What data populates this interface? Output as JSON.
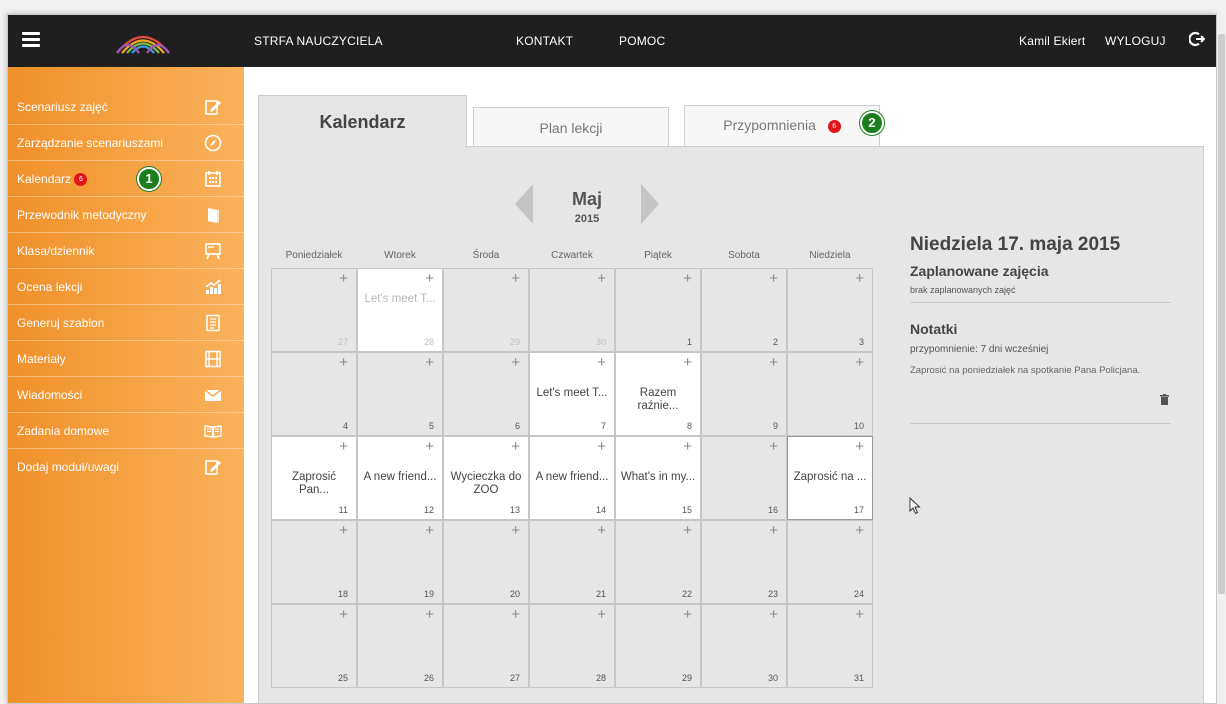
{
  "header": {
    "title": "STRFA NAUCZYCIELA",
    "kontakt": "KONTAKT",
    "pomoc": "POMOC",
    "user": "Kamil Ekiert",
    "logout": "WYLOGUJ",
    "icons": [
      "menu-icon",
      "rainbow-logo",
      "logout-icon"
    ]
  },
  "sidebar": {
    "items": [
      {
        "label": "Scenariusz zajęć",
        "icon": "edit-icon"
      },
      {
        "label": "Zarządzanie scenariuszami",
        "icon": "compass-icon"
      },
      {
        "label": "Kalendarz",
        "icon": "calendar-icon",
        "badge": "6",
        "marker": "1"
      },
      {
        "label": "Przewodnik metodyczny",
        "icon": "book-icon"
      },
      {
        "label": "Klasa/dziennik",
        "icon": "blackboard-icon"
      },
      {
        "label": "Ocena lekcji",
        "icon": "chart-icon"
      },
      {
        "label": "Generuj szablon",
        "icon": "document-icon"
      },
      {
        "label": "Materiały",
        "icon": "film-icon"
      },
      {
        "label": "Wiadomości",
        "icon": "envelope-icon"
      },
      {
        "label": "Zadania domowe",
        "icon": "open-book-icon"
      },
      {
        "label": "Dodaj moduł/uwagi",
        "icon": "edit-icon"
      }
    ]
  },
  "tabs": {
    "calendar": "Kalendarz",
    "plan": "Plan lekcji",
    "reminders": "Przypomnienia",
    "reminders_badge": "6",
    "reminders_marker": "2"
  },
  "calendar": {
    "month": "Maj",
    "year": "2015",
    "weekdays": [
      "Poniedziałek",
      "Wtorek",
      "Środa",
      "Czwartek",
      "Piątek",
      "Sobota",
      "Niedziela"
    ],
    "weeks": [
      [
        {
          "day": "27",
          "faded": true,
          "event": "",
          "active": false
        },
        {
          "day": "28",
          "faded": true,
          "event": "Let's meet T...",
          "active": true
        },
        {
          "day": "29",
          "faded": true,
          "event": "",
          "active": false
        },
        {
          "day": "30",
          "faded": true,
          "event": "",
          "active": false
        },
        {
          "day": "1",
          "faded": false,
          "event": "",
          "active": false
        },
        {
          "day": "2",
          "faded": false,
          "event": "",
          "active": false
        },
        {
          "day": "3",
          "faded": false,
          "event": "",
          "active": false
        }
      ],
      [
        {
          "day": "4",
          "faded": false,
          "event": "",
          "active": false
        },
        {
          "day": "5",
          "faded": false,
          "event": "",
          "active": false
        },
        {
          "day": "6",
          "faded": false,
          "event": "",
          "active": false
        },
        {
          "day": "7",
          "faded": false,
          "event": "Let's meet T...",
          "active": true
        },
        {
          "day": "8",
          "faded": false,
          "event": "Razem raźnie...",
          "active": true
        },
        {
          "day": "9",
          "faded": false,
          "event": "",
          "active": false
        },
        {
          "day": "10",
          "faded": false,
          "event": "",
          "active": false
        }
      ],
      [
        {
          "day": "11",
          "faded": false,
          "event": "Zaprosić Pan...",
          "active": true
        },
        {
          "day": "12",
          "faded": false,
          "event": "A new friend...",
          "active": true
        },
        {
          "day": "13",
          "faded": false,
          "event": "Wycieczka do ZOO",
          "active": true
        },
        {
          "day": "14",
          "faded": false,
          "event": "A new friend...",
          "active": true
        },
        {
          "day": "15",
          "faded": false,
          "event": "What's in my...",
          "active": true
        },
        {
          "day": "16",
          "faded": false,
          "event": "",
          "active": false
        },
        {
          "day": "17",
          "faded": false,
          "event": "Zaprosić na ...",
          "active": true,
          "today": true
        }
      ],
      [
        {
          "day": "18",
          "faded": false,
          "event": "",
          "active": false
        },
        {
          "day": "19",
          "faded": false,
          "event": "",
          "active": false
        },
        {
          "day": "20",
          "faded": false,
          "event": "",
          "active": false
        },
        {
          "day": "21",
          "faded": false,
          "event": "",
          "active": false
        },
        {
          "day": "22",
          "faded": false,
          "event": "",
          "active": false
        },
        {
          "day": "23",
          "faded": false,
          "event": "",
          "active": false
        },
        {
          "day": "24",
          "faded": false,
          "event": "",
          "active": false
        }
      ],
      [
        {
          "day": "25",
          "faded": false,
          "event": "",
          "active": false
        },
        {
          "day": "26",
          "faded": false,
          "event": "",
          "active": false
        },
        {
          "day": "27",
          "faded": false,
          "event": "",
          "active": false
        },
        {
          "day": "28",
          "faded": false,
          "event": "",
          "active": false
        },
        {
          "day": "29",
          "faded": false,
          "event": "",
          "active": false
        },
        {
          "day": "30",
          "faded": false,
          "event": "",
          "active": false
        },
        {
          "day": "31",
          "faded": false,
          "event": "",
          "active": false
        }
      ]
    ],
    "add_symbol": "+"
  },
  "details": {
    "date_title": "Niedziela 17. maja 2015",
    "scheduled_heading": "Zaplanowane zajęcia",
    "scheduled_empty": "brak zaplanowanych zajęć",
    "notes_heading": "Notatki",
    "reminder": "przypomnienie: 7 dni wcześniej",
    "note_text": "Zaprosić na poniedziałek na spotkanie Pana Policjana."
  },
  "colors": {
    "sidebar_orange": "#f0902a",
    "topbar": "#1f1f1f",
    "badge_red": "#e2141a",
    "marker_green": "#1c7d1c"
  }
}
